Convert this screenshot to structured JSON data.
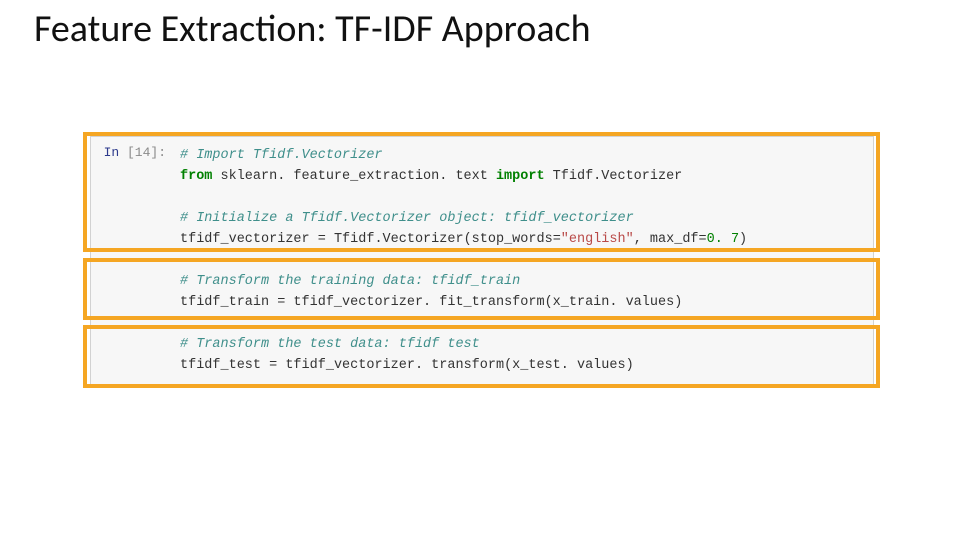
{
  "title": "Feature Extraction: TF-IDF Approach",
  "cell": {
    "prompt_in": "In ",
    "prompt_num": "[14]:"
  },
  "code": {
    "l1_comment": "# Import Tfidf.Vectorizer",
    "l2_from": "from",
    "l2_mod": " sklearn. feature_extraction. text ",
    "l2_import": "import",
    "l2_name": " Tfidf.Vectorizer",
    "l3_blank": "",
    "l4_comment": "# Initialize a Tfidf.Vectorizer object: tfidf_vectorizer",
    "l5_a": "tfidf_vectorizer ",
    "l5_eq": "=",
    "l5_b": " Tfidf.Vectorizer(stop_words",
    "l5_eq2": "=",
    "l5_str": "\"english\"",
    "l5_c": ", max_df",
    "l5_eq3": "=",
    "l5_num": "0. 7",
    "l5_d": ")",
    "l6_blank": "",
    "l7_comment": "# Transform the training data: tfidf_train",
    "l8_a": "tfidf_train ",
    "l8_eq": "=",
    "l8_b": " tfidf_vectorizer. fit_transform(x_train. values)",
    "l9_blank": "",
    "l10_comment": "# Transform the test data: tfidf test",
    "l11_a": "tfidf_test ",
    "l11_eq": "=",
    "l11_b": " tfidf_vectorizer. transform(x_test. values)"
  }
}
